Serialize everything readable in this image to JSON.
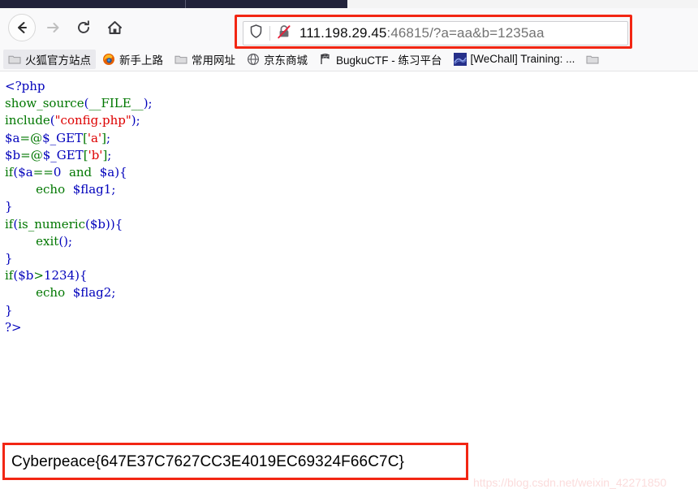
{
  "browser": {
    "nav": {
      "back_label": "Back",
      "forward_label": "Forward",
      "reload_label": "Reload",
      "home_label": "Home"
    },
    "urlbar": {
      "host": "111.198.29.45",
      "path": ":46815/?a=aa&b=1235aa",
      "full_url": "111.198.29.45:46815/?a=aa&b=1235aa",
      "shield_icon": "shield-icon",
      "security_icon": "lock-crossed-icon",
      "highlight_color": "#f22613"
    },
    "bookmarks": [
      {
        "label": "火狐官方站点",
        "icon": "folder-icon",
        "selected": true
      },
      {
        "label": "新手上路",
        "icon": "firefox-icon",
        "selected": false
      },
      {
        "label": "常用网址",
        "icon": "folder-icon",
        "selected": false
      },
      {
        "label": "京东商城",
        "icon": "globe-icon",
        "selected": false
      },
      {
        "label": "BugkuCTF - 练习平台",
        "icon": "flag-checkered-icon",
        "selected": false
      },
      {
        "label": "[WeChall] Training: ...",
        "icon": "wechall-icon",
        "selected": false
      },
      {
        "label": "",
        "icon": "folder-icon",
        "selected": false
      }
    ]
  },
  "page": {
    "code_lines": [
      [
        {
          "t": "<?php",
          "c": "v"
        }
      ],
      [
        {
          "t": "show_source",
          "c": "k"
        },
        {
          "t": "(",
          "c": "v"
        },
        {
          "t": "__FILE__",
          "c": "k"
        },
        {
          "t": ")",
          "c": "v"
        },
        {
          "t": ";",
          "c": "v"
        }
      ],
      [
        {
          "t": "include",
          "c": "k"
        },
        {
          "t": "(",
          "c": "v"
        },
        {
          "t": "\"config.php\"",
          "c": "s"
        },
        {
          "t": ")",
          "c": "v"
        },
        {
          "t": ";",
          "c": "v"
        }
      ],
      [
        {
          "t": "$a",
          "c": "v"
        },
        {
          "t": "=@",
          "c": "k"
        },
        {
          "t": "$_GET",
          "c": "v"
        },
        {
          "t": "[",
          "c": "k"
        },
        {
          "t": "'a'",
          "c": "s"
        },
        {
          "t": "]",
          "c": "k"
        },
        {
          "t": ";",
          "c": "v"
        }
      ],
      [
        {
          "t": "$b",
          "c": "v"
        },
        {
          "t": "=@",
          "c": "k"
        },
        {
          "t": "$_GET",
          "c": "v"
        },
        {
          "t": "[",
          "c": "k"
        },
        {
          "t": "'b'",
          "c": "s"
        },
        {
          "t": "]",
          "c": "k"
        },
        {
          "t": ";",
          "c": "v"
        }
      ],
      [
        {
          "t": "if",
          "c": "k"
        },
        {
          "t": "(",
          "c": "v"
        },
        {
          "t": "$a",
          "c": "v"
        },
        {
          "t": "==",
          "c": "k"
        },
        {
          "t": "0",
          "c": "v"
        },
        {
          "t": "  ",
          "c": "v"
        },
        {
          "t": "and",
          "c": "k"
        },
        {
          "t": "  ",
          "c": "v"
        },
        {
          "t": "$a",
          "c": "v"
        },
        {
          "t": ")",
          "c": "v"
        },
        {
          "t": "{",
          "c": "v"
        }
      ],
      [
        {
          "t": "        ",
          "c": "v"
        },
        {
          "t": "echo",
          "c": "k"
        },
        {
          "t": "  ",
          "c": "v"
        },
        {
          "t": "$flag1",
          "c": "v"
        },
        {
          "t": ";",
          "c": "v"
        }
      ],
      [
        {
          "t": "}",
          "c": "v"
        }
      ],
      [
        {
          "t": "if",
          "c": "k"
        },
        {
          "t": "(",
          "c": "v"
        },
        {
          "t": "is_numeric",
          "c": "k"
        },
        {
          "t": "(",
          "c": "v"
        },
        {
          "t": "$b",
          "c": "v"
        },
        {
          "t": "))",
          "c": "v"
        },
        {
          "t": "{",
          "c": "v"
        }
      ],
      [
        {
          "t": "        ",
          "c": "v"
        },
        {
          "t": "exit",
          "c": "k"
        },
        {
          "t": "()",
          "c": "v"
        },
        {
          "t": ";",
          "c": "v"
        }
      ],
      [
        {
          "t": "}",
          "c": "v"
        }
      ],
      [
        {
          "t": "if",
          "c": "k"
        },
        {
          "t": "(",
          "c": "v"
        },
        {
          "t": "$b",
          "c": "v"
        },
        {
          "t": ">",
          "c": "k"
        },
        {
          "t": "1234",
          "c": "v"
        },
        {
          "t": ")",
          "c": "v"
        },
        {
          "t": "{",
          "c": "v"
        }
      ],
      [
        {
          "t": "        ",
          "c": "v"
        },
        {
          "t": "echo",
          "c": "k"
        },
        {
          "t": "  ",
          "c": "v"
        },
        {
          "t": "$flag2",
          "c": "v"
        },
        {
          "t": ";",
          "c": "v"
        }
      ],
      [
        {
          "t": "}",
          "c": "v"
        }
      ],
      [
        {
          "t": "?>",
          "c": "v"
        }
      ]
    ],
    "flag": "Cyberpeace{647E37C7627CC3E4019EC69324F66C7C}",
    "flag_highlight_color": "#f22613",
    "watermark": "https://blog.csdn.net/weixin_42271850"
  }
}
